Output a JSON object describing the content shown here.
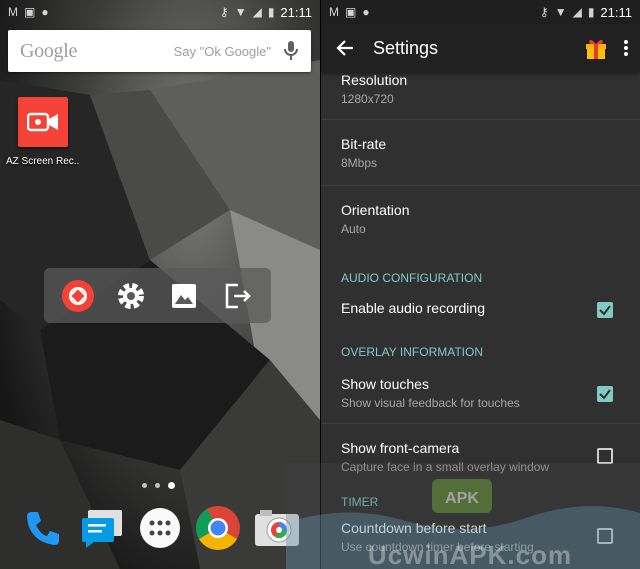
{
  "statusbar": {
    "time_left": "21:11",
    "time_right": "21:11"
  },
  "search": {
    "logo": "Google",
    "hint": "Say \"Ok Google\""
  },
  "home": {
    "app_label": "AZ Screen Rec..",
    "floating_controls": [
      "record-icon",
      "gear-icon",
      "image-icon",
      "exit-icon"
    ],
    "dock": [
      "phone-icon",
      "messages-icon",
      "app-drawer-icon",
      "chrome-icon",
      "camera-icon"
    ]
  },
  "settings": {
    "title": "Settings",
    "items": [
      {
        "title": "Resolution",
        "summary": "1280x720"
      },
      {
        "title": "Bit-rate",
        "summary": "8Mbps"
      },
      {
        "title": "Orientation",
        "summary": "Auto"
      }
    ],
    "section_audio": "AUDIO CONFIGURATION",
    "audio": {
      "title": "Enable audio recording",
      "checked": true
    },
    "section_overlay": "OVERLAY INFORMATION",
    "touches": {
      "title": "Show touches",
      "summary": "Show visual feedback for touches",
      "checked": true
    },
    "camera": {
      "title": "Show front-camera",
      "summary": "Capture face in a small overlay window",
      "checked": false
    },
    "section_timer": "TIMER",
    "countdown": {
      "title": "Countdown before start",
      "summary": "Use countdown timer before starting",
      "checked": false
    }
  },
  "watermark": {
    "text": "UcwinAPK.com"
  },
  "colors": {
    "accent": "#80cbc4",
    "toolbar": "#212121",
    "background": "#303030",
    "recorder_red": "#f44336"
  }
}
